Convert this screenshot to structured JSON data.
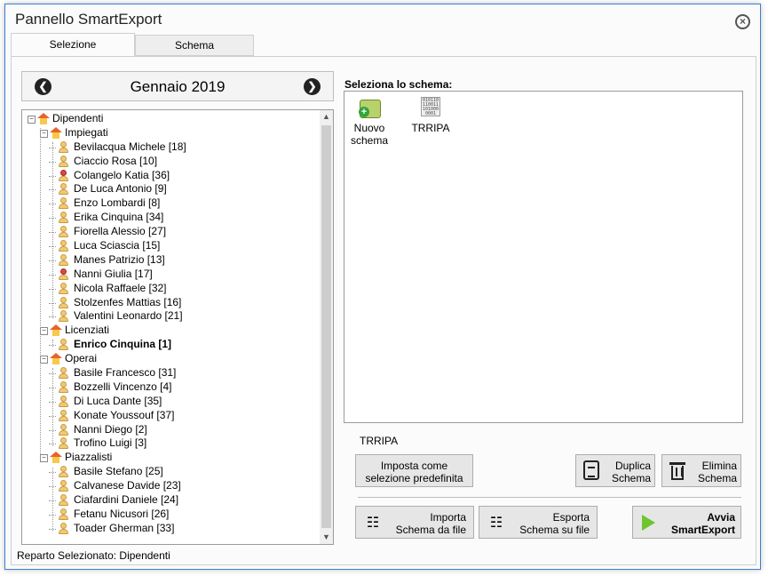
{
  "window": {
    "title": "Pannello SmartExport",
    "close_icon": "⊗"
  },
  "tabs": [
    {
      "label": "Selezione",
      "active": true
    },
    {
      "label": "Schema",
      "active": false
    }
  ],
  "nav": {
    "month": "Gennaio 2019",
    "prev_icon": "◀",
    "next_icon": "▶"
  },
  "tree": {
    "nodes": [
      {
        "level": 0,
        "type": "group",
        "label": "Dipendenti",
        "expanded": true
      },
      {
        "level": 1,
        "type": "group",
        "label": "Impiegati",
        "expanded": true
      },
      {
        "level": 2,
        "type": "male",
        "label": "Bevilacqua Michele  [18]"
      },
      {
        "level": 2,
        "type": "male",
        "label": "Ciaccio Rosa  [10]"
      },
      {
        "level": 2,
        "type": "female",
        "label": "Colangelo Katia [36]"
      },
      {
        "level": 2,
        "type": "male",
        "label": "De Luca Antonio  [9]"
      },
      {
        "level": 2,
        "type": "male",
        "label": "Enzo Lombardi  [8]"
      },
      {
        "level": 2,
        "type": "male",
        "label": "Erika Cinquina  [34]"
      },
      {
        "level": 2,
        "type": "male",
        "label": "Fiorella Alessio  [27]"
      },
      {
        "level": 2,
        "type": "male",
        "label": "Luca Sciascia  [15]"
      },
      {
        "level": 2,
        "type": "male",
        "label": "Manes Patrizio  [13]"
      },
      {
        "level": 2,
        "type": "female",
        "label": "Nanni Giulia  [17]"
      },
      {
        "level": 2,
        "type": "male",
        "label": "Nicola Raffaele  [32]"
      },
      {
        "level": 2,
        "type": "male",
        "label": "Stolzenfes Mattias  [16]"
      },
      {
        "level": 2,
        "type": "male",
        "label": "Valentini Leonardo  [21]"
      },
      {
        "level": 1,
        "type": "group",
        "label": "Licenziati",
        "expanded": true
      },
      {
        "level": 2,
        "type": "male",
        "label": "Enrico Cinquina  [1]",
        "bold": true
      },
      {
        "level": 1,
        "type": "group",
        "label": "Operai",
        "expanded": true
      },
      {
        "level": 2,
        "type": "male",
        "label": "Basile Francesco [31]"
      },
      {
        "level": 2,
        "type": "male",
        "label": "Bozzelli Vincenzo  [4]"
      },
      {
        "level": 2,
        "type": "male",
        "label": "Di Luca Dante  [35]"
      },
      {
        "level": 2,
        "type": "male",
        "label": "Konate Youssouf [37]"
      },
      {
        "level": 2,
        "type": "male",
        "label": "Nanni Diego  [2]"
      },
      {
        "level": 2,
        "type": "male",
        "label": "Trofino Luigi  [3]"
      },
      {
        "level": 1,
        "type": "group",
        "label": "Piazzalisti",
        "expanded": true
      },
      {
        "level": 2,
        "type": "male",
        "label": "Basile Stefano  [25]"
      },
      {
        "level": 2,
        "type": "male",
        "label": "Calvanese Davide  [23]"
      },
      {
        "level": 2,
        "type": "male",
        "label": "Ciafardini Daniele  [24]"
      },
      {
        "level": 2,
        "type": "male",
        "label": "Fetanu Nicusori  [26]"
      },
      {
        "level": 2,
        "type": "male",
        "label": "Toader Gherman  [33]"
      }
    ],
    "scroll_up_icon": "▲",
    "scroll_down_icon": "▼"
  },
  "status": {
    "text": "Reparto Selezionato: Dipendenti"
  },
  "schema": {
    "heading": "Seleziona lo schema:",
    "items": [
      {
        "label_line1": "Nuovo",
        "label_line2": "schema",
        "icon": "new-schema-icon"
      },
      {
        "label_line1": "TRRIPA",
        "label_line2": "",
        "icon": "binary-file-icon",
        "icon_text": "010110 110011 101000 0001"
      }
    ],
    "selected_name": "TRRIPA"
  },
  "buttons": {
    "default_line1": "Imposta come",
    "default_line2": "selezione predefinita",
    "duplicate_line1": "Duplica",
    "duplicate_line2": "Schema",
    "delete_line1": "Elimina",
    "delete_line2": "Schema",
    "import_line1": "Importa",
    "import_line2": "Schema da file",
    "export_line1": "Esporta",
    "export_line2": "Schema su file",
    "start_line1": "Avvia",
    "start_line2": "SmartExport"
  },
  "colors": {
    "accent": "#3b7fd4",
    "start_icon": "#6fc52f"
  }
}
